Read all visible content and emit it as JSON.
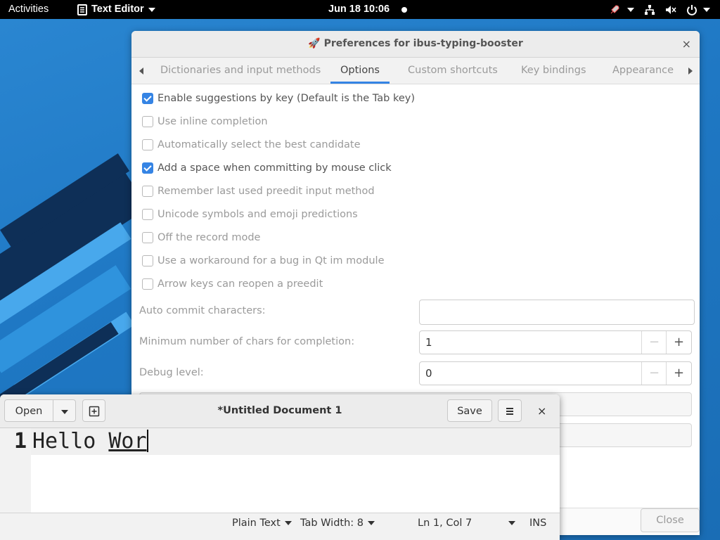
{
  "topbar": {
    "activities": "Activities",
    "app_menu": "Text Editor",
    "clock": "Jun 18  10:06"
  },
  "prefs": {
    "title": "🚀 Preferences for ibus-typing-booster",
    "close_symbol": "×",
    "tabs": [
      "Dictionaries and input methods",
      "Options",
      "Custom shortcuts",
      "Key bindings",
      "Appearance"
    ],
    "active_tab": "Options",
    "options": [
      {
        "label": "Enable suggestions by key (Default is the Tab key)",
        "checked": true
      },
      {
        "label": "Use inline completion",
        "checked": false
      },
      {
        "label": "Automatically select the best candidate",
        "checked": false
      },
      {
        "label": "Add a space when committing by mouse click",
        "checked": true
      },
      {
        "label": "Remember last used preedit input method",
        "checked": false
      },
      {
        "label": "Unicode symbols and emoji predictions",
        "checked": false
      },
      {
        "label": "Off the record mode",
        "checked": false
      },
      {
        "label": "Use a workaround for a bug in Qt im module",
        "checked": false
      },
      {
        "label": "Arrow keys can reopen a preedit",
        "checked": false
      }
    ],
    "auto_commit_label": "Auto commit characters:",
    "auto_commit_value": "",
    "min_chars_label": "Minimum number of chars for completion:",
    "min_chars_value": "1",
    "debug_label": "Debug level:",
    "debug_value": "0",
    "close_button": "Close"
  },
  "editor": {
    "open_label": "Open",
    "title": "*Untitled Document 1",
    "save_label": "Save",
    "close_symbol": "×",
    "line_number": "1",
    "committed_text": "Hello ",
    "preedit_text": "Wor",
    "status": {
      "language": "Plain Text",
      "tab_width": "Tab Width: 8",
      "position": "Ln 1, Col 7",
      "mode": "INS"
    }
  },
  "colors": {
    "accent": "#3584e4",
    "topbar_bg": "#000000",
    "wallpaper": "#1f78c4"
  }
}
